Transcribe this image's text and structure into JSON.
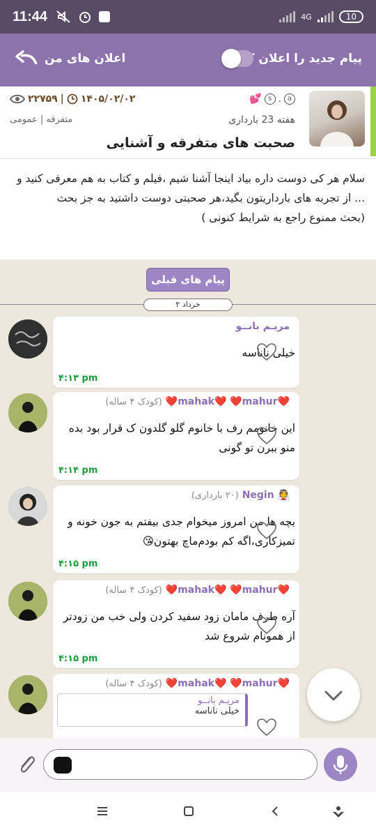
{
  "status": {
    "time": "11:44",
    "net": "4G",
    "battery": "10"
  },
  "header": {
    "notify_label": "پیام جدید را اعلان کن",
    "my_ads": "اعلان های من"
  },
  "topic": {
    "week": "هفته 23 بارداری",
    "title": "صحبت های متفرقه و آشنایی",
    "date": "۱۴۰۵/۰۲/۰۲",
    "views": "۲۲۷۵۹",
    "category": "متفرقه | عمومی"
  },
  "description": "سلام هر کی دوست داره بیاد اینجا آشنا شیم ،فیلم و کتاب به هم معرفی کنید و ... از تجربه های بارداریتون بگید،هر صحبتی دوست داشتید به جز بحث\n(بحث  ممنوع راجع به شرایط کنونی )",
  "chat": {
    "prev_button": "پیام های قبلی",
    "date_divider": "۲ خرداد",
    "messages": [
      {
        "sender": "مریـم بانــو",
        "sub": "",
        "text": "خیلی ناناسه",
        "time": "۴:۱۳ pm"
      },
      {
        "sender": "❤️mahak❤️ ❤️mahur❤️",
        "sub": "(کودک ۴ ساله)",
        "text": "این خانومم رف با خانوم گلو گلدون ک قرار بود بده منو ببرن تو گونی",
        "time": "۴:۱۴ pm"
      },
      {
        "sender": "👰 Negin",
        "sub": "(۲۰ بارداری)",
        "text": "بچه ها من امروز میخوام جدی بیفتم به جون خونه و تمیزکاری،اگه کم بودم‌ماچ بهتون😘",
        "time": "۴:۱۵ pm"
      },
      {
        "sender": "❤️mahak❤️ ❤️mahur❤️",
        "sub": "(کودک ۴ ساله)",
        "text": "آره طرف مامان زود سفید کردن ولی خب من زودتر از همونام شروع شد",
        "time": "۴:۱۵ pm"
      },
      {
        "sender": "❤️mahak❤️ ❤️mahur❤️",
        "sub": "(کودک ۴ ساله)",
        "reply_name": "مریـم بانــو",
        "reply_text": "خیلی ناناسه"
      }
    ]
  }
}
